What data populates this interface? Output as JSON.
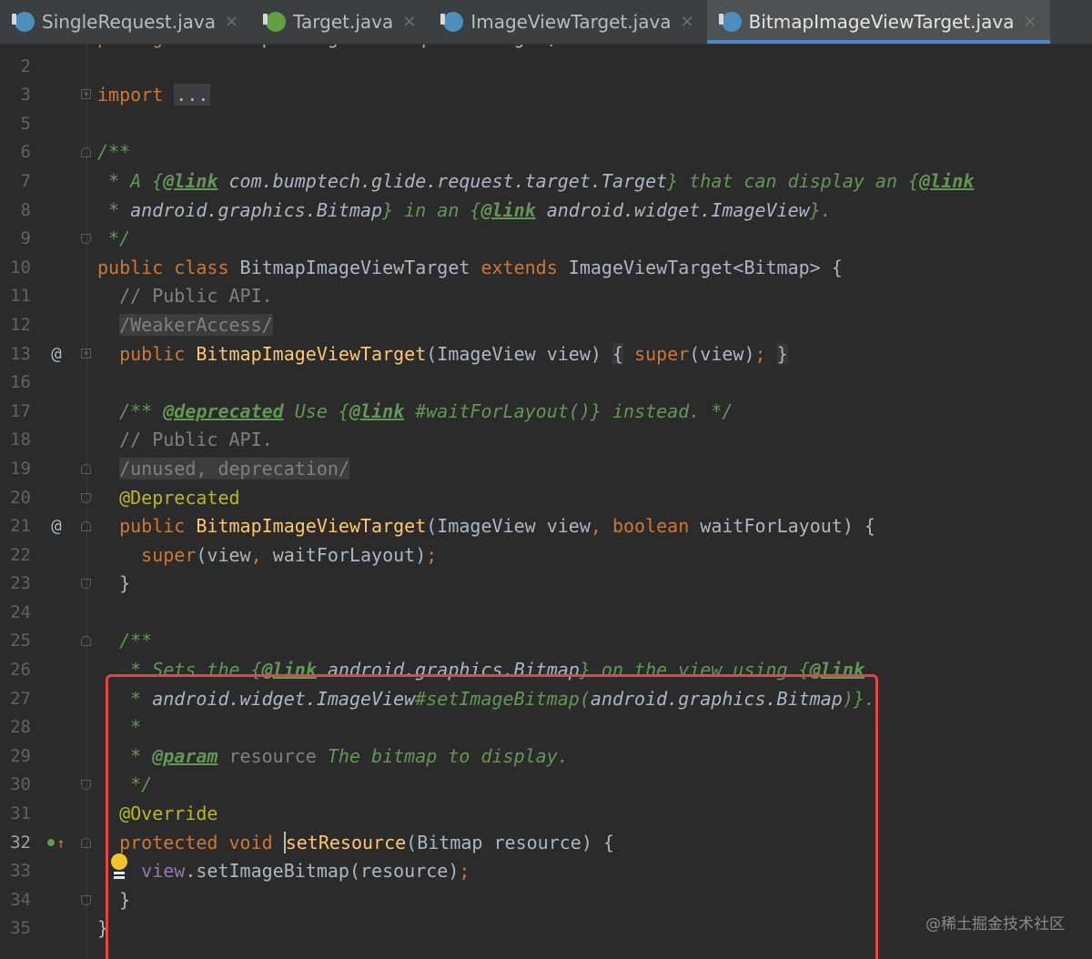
{
  "tabs": [
    {
      "label": "SingleRequest.java",
      "icon": "class-icon",
      "active": false
    },
    {
      "label": "Target.java",
      "icon": "interface-icon",
      "active": false
    },
    {
      "label": "ImageViewTarget.java",
      "icon": "class-icon",
      "active": false
    },
    {
      "label": "BitmapImageViewTarget.java",
      "icon": "class-icon",
      "active": true
    }
  ],
  "tab_close_glyph": "×",
  "current_line": "32",
  "lines": [
    {
      "n": "1",
      "fold": "",
      "mark": "",
      "segs": [
        [
          "kw",
          "package "
        ],
        [
          "plain",
          "com.bumptech.glide.request.target;"
        ]
      ]
    },
    {
      "n": "2",
      "fold": "",
      "mark": "",
      "segs": []
    },
    {
      "n": "3",
      "fold": "plus",
      "mark": "",
      "segs": [
        [
          "kw",
          "import "
        ],
        [
          "folded",
          "..."
        ]
      ]
    },
    {
      "n": "5",
      "fold": "",
      "mark": "",
      "segs": []
    },
    {
      "n": "6",
      "fold": "start",
      "mark": "",
      "segs": [
        [
          "doc",
          "/**"
        ]
      ]
    },
    {
      "n": "7",
      "fold": "",
      "mark": "",
      "segs": [
        [
          "doc",
          " * A {"
        ],
        [
          "doctag",
          "@link"
        ],
        [
          "docref",
          " com.bumptech.glide.request.target.Target"
        ],
        [
          "doc",
          "} that can display an {"
        ],
        [
          "doctag",
          "@link"
        ]
      ]
    },
    {
      "n": "8",
      "fold": "",
      "mark": "",
      "segs": [
        [
          "doc",
          " * "
        ],
        [
          "docref",
          "android.graphics.Bitmap"
        ],
        [
          "doc",
          "} in an {"
        ],
        [
          "doctag",
          "@link"
        ],
        [
          "docref",
          " android.widget.ImageView"
        ],
        [
          "doc",
          "}."
        ]
      ]
    },
    {
      "n": "9",
      "fold": "end",
      "mark": "",
      "segs": [
        [
          "doc",
          " */"
        ]
      ]
    },
    {
      "n": "10",
      "fold": "",
      "mark": "",
      "segs": [
        [
          "kw",
          "public class "
        ],
        [
          "plain",
          "BitmapImageViewTarget "
        ],
        [
          "kw",
          "extends "
        ],
        [
          "plain",
          "ImageViewTarget<Bitmap> {"
        ]
      ]
    },
    {
      "n": "11",
      "fold": "",
      "mark": "",
      "segs": [
        [
          "comment",
          "  // Public API."
        ]
      ]
    },
    {
      "n": "12",
      "fold": "",
      "mark": "",
      "segs": [
        [
          "plain",
          "  "
        ],
        [
          "suppress",
          "/WeakerAccess/"
        ]
      ]
    },
    {
      "n": "13",
      "fold": "plus",
      "mark": "@",
      "segs": [
        [
          "kw",
          "  public "
        ],
        [
          "method",
          "BitmapImageViewTarget"
        ],
        [
          "plain",
          "(ImageView view) "
        ],
        [
          "brace",
          "{"
        ],
        [
          "plain",
          " "
        ],
        [
          "kw",
          "super"
        ],
        [
          "plain",
          "(view)"
        ],
        [
          "kw",
          ";"
        ],
        [
          "plain",
          " "
        ],
        [
          "brace",
          "}"
        ]
      ]
    },
    {
      "n": "16",
      "fold": "",
      "mark": "",
      "segs": []
    },
    {
      "n": "17",
      "fold": "",
      "mark": "",
      "segs": [
        [
          "doc",
          "  /** "
        ],
        [
          "doctag",
          "@deprecated"
        ],
        [
          "doc",
          " Use {"
        ],
        [
          "doctag",
          "@link"
        ],
        [
          "doc",
          " #waitForLayout()} instead. */"
        ]
      ]
    },
    {
      "n": "18",
      "fold": "",
      "mark": "",
      "segs": [
        [
          "comment",
          "  // Public API."
        ]
      ]
    },
    {
      "n": "19",
      "fold": "start",
      "mark": "",
      "segs": [
        [
          "plain",
          "  "
        ],
        [
          "suppress",
          "/unused, deprecation/"
        ]
      ]
    },
    {
      "n": "20",
      "fold": "end",
      "mark": "",
      "segs": [
        [
          "annot",
          "  @Deprecated"
        ]
      ]
    },
    {
      "n": "21",
      "fold": "start",
      "mark": "@",
      "segs": [
        [
          "kw",
          "  public "
        ],
        [
          "method",
          "BitmapImageViewTarget"
        ],
        [
          "plain",
          "(ImageView view"
        ],
        [
          "kw",
          ", boolean "
        ],
        [
          "plain",
          "waitForLayout) {"
        ]
      ]
    },
    {
      "n": "22",
      "fold": "",
      "mark": "",
      "segs": [
        [
          "kw",
          "    super"
        ],
        [
          "plain",
          "(view"
        ],
        [
          "kw",
          ", "
        ],
        [
          "plain",
          "waitForLayout)"
        ],
        [
          "kw",
          ";"
        ]
      ]
    },
    {
      "n": "23",
      "fold": "end",
      "mark": "",
      "segs": [
        [
          "plain",
          "  }"
        ]
      ]
    },
    {
      "n": "24",
      "fold": "",
      "mark": "",
      "segs": []
    },
    {
      "n": "25",
      "fold": "start",
      "mark": "",
      "segs": [
        [
          "doc",
          "  /**"
        ]
      ]
    },
    {
      "n": "26",
      "fold": "",
      "mark": "",
      "segs": [
        [
          "doc",
          "   * Sets the {"
        ],
        [
          "doctag",
          "@link"
        ],
        [
          "docref",
          " android.graphics.Bitmap"
        ],
        [
          "doc",
          "} on the view using {"
        ],
        [
          "doctag",
          "@link"
        ]
      ]
    },
    {
      "n": "27",
      "fold": "",
      "mark": "",
      "segs": [
        [
          "doc",
          "   * "
        ],
        [
          "docref",
          "android.widget.ImageView"
        ],
        [
          "doc",
          "#setImageBitmap("
        ],
        [
          "docref",
          "android.graphics.Bitmap"
        ],
        [
          "doc",
          ")}."
        ]
      ]
    },
    {
      "n": "28",
      "fold": "",
      "mark": "",
      "segs": [
        [
          "doc",
          "   *"
        ]
      ]
    },
    {
      "n": "29",
      "fold": "",
      "mark": "",
      "segs": [
        [
          "doc",
          "   * "
        ],
        [
          "doctag",
          "@param"
        ],
        [
          "comment",
          " resource"
        ],
        [
          "doc",
          " The bitmap to display."
        ]
      ]
    },
    {
      "n": "30",
      "fold": "end",
      "mark": "",
      "segs": [
        [
          "doc",
          "   */"
        ]
      ]
    },
    {
      "n": "31",
      "fold": "",
      "mark": "",
      "segs": [
        [
          "annot",
          "  @Override"
        ]
      ]
    },
    {
      "n": "32",
      "fold": "start",
      "mark": "override",
      "segs": [
        [
          "kw",
          "  protected void "
        ],
        [
          "cursor",
          ""
        ],
        [
          "method",
          "setResource"
        ],
        [
          "plain",
          "(Bitmap resource) {"
        ]
      ]
    },
    {
      "n": "33",
      "fold": "",
      "mark": "",
      "segs": [
        [
          "field",
          "    view"
        ],
        [
          "plain",
          ".setImageBitmap(resource)"
        ],
        [
          "kw",
          ";"
        ]
      ]
    },
    {
      "n": "34",
      "fold": "end",
      "mark": "",
      "segs": [
        [
          "plain",
          "  }"
        ]
      ]
    },
    {
      "n": "35",
      "fold": "",
      "mark": "",
      "segs": [
        [
          "plain",
          "}"
        ]
      ]
    }
  ],
  "gutter_marks": {
    "at": "@",
    "override": "↑"
  },
  "watermark": "@稀土掘金技术社区"
}
